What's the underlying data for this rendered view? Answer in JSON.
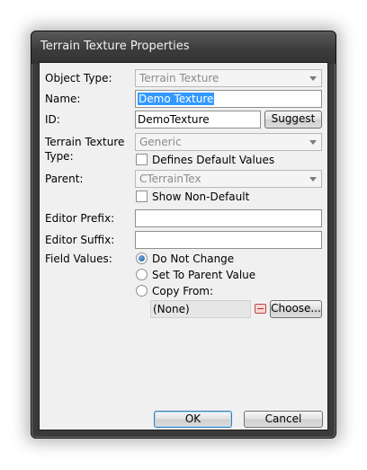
{
  "window": {
    "title": "Terrain Texture Properties"
  },
  "labels": {
    "object_type": "Object Type:",
    "name": "Name:",
    "id": "ID:",
    "terrain_texture_type_line1": "Terrain Texture",
    "terrain_texture_type_line2": "Type:",
    "parent": "Parent:",
    "editor_prefix": "Editor Prefix:",
    "editor_suffix": "Editor Suffix:",
    "field_values": "Field Values:"
  },
  "fields": {
    "object_type": "Terrain Texture",
    "name": "Demo Texture",
    "id": "DemoTexture",
    "terrain_texture_type": "Generic",
    "parent": "CTerrainTex",
    "editor_prefix": "",
    "editor_suffix": "",
    "copy_from": "(None)"
  },
  "checkboxes": {
    "defines_default_values": {
      "label": "Defines Default Values",
      "checked": false
    },
    "show_non_default": {
      "label": "Show Non-Default",
      "checked": false
    }
  },
  "radios": {
    "options": [
      {
        "label": "Do Not Change",
        "selected": true
      },
      {
        "label": "Set To Parent Value",
        "selected": false
      },
      {
        "label": "Copy From:",
        "selected": false
      }
    ]
  },
  "buttons": {
    "suggest": "Suggest",
    "choose": "Choose...",
    "ok": "OK",
    "cancel": "Cancel"
  },
  "icons": {
    "clear": "clear-icon",
    "dropdown": "chevron-down-icon"
  },
  "colors": {
    "selection": "#3399ff",
    "default_button_border": "#3c7fb1",
    "dialog_background": "#f0f0f0"
  }
}
